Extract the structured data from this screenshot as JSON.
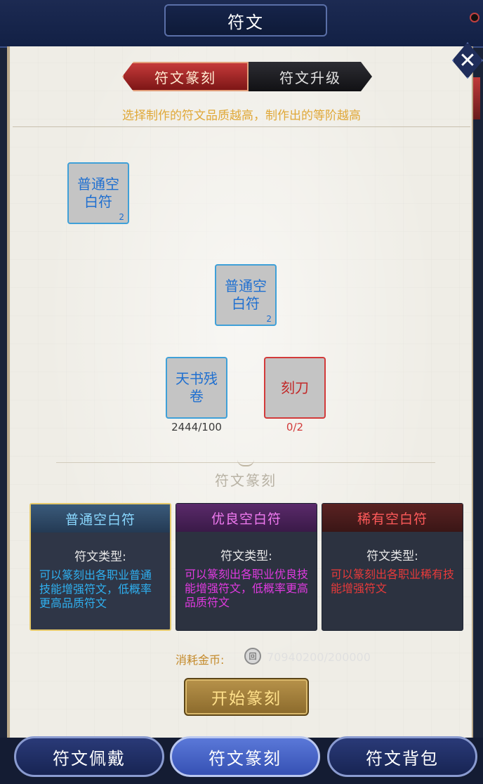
{
  "window": {
    "title": "符文"
  },
  "tabs": [
    {
      "label": "符文篆刻",
      "active": true
    },
    {
      "label": "符文升级",
      "active": false
    }
  ],
  "hint": "选择制作的符文品质越高，制作出的等阶越高",
  "slots": {
    "result_top": {
      "name": "普通空白符",
      "count": "2"
    },
    "result_center": {
      "name": "普通空白符",
      "count": "2"
    },
    "material_book": {
      "name": "天书残卷",
      "qty": "2444/100"
    },
    "material_knife": {
      "name": "刻刀",
      "qty": "0/2"
    }
  },
  "section_label": "符文篆刻",
  "cards": [
    {
      "title": "普通空白符",
      "type_label": "符文类型:",
      "desc": "可以篆刻出各职业普通技能增强符文，低概率更高品质符文",
      "selected": true,
      "color": "#2fb0f0"
    },
    {
      "title": "优良空白符",
      "type_label": "符文类型:",
      "desc": "可以篆刻出各职业优良技能增强符文，低概率更高品质符文",
      "selected": false,
      "color": "#e03ae0"
    },
    {
      "title": "稀有空白符",
      "type_label": "符文类型:",
      "desc": "可以篆刻出各职业稀有技能增强符文",
      "selected": false,
      "color": "#e83a3a"
    }
  ],
  "cost": {
    "label": "消耗金币:",
    "value": "70940200/200000"
  },
  "start_button": "开始篆刻",
  "bottom_nav": [
    {
      "label": "符文佩戴",
      "active": false
    },
    {
      "label": "符文篆刻",
      "active": true
    },
    {
      "label": "符文背包",
      "active": false
    }
  ],
  "colors": {
    "accent_red": "#c53a3a",
    "slot_blue": "#3fa0d8",
    "qty_ok": "#3a3a3a",
    "qty_bad": "#d23a3a",
    "gold": "#c48a2a"
  }
}
